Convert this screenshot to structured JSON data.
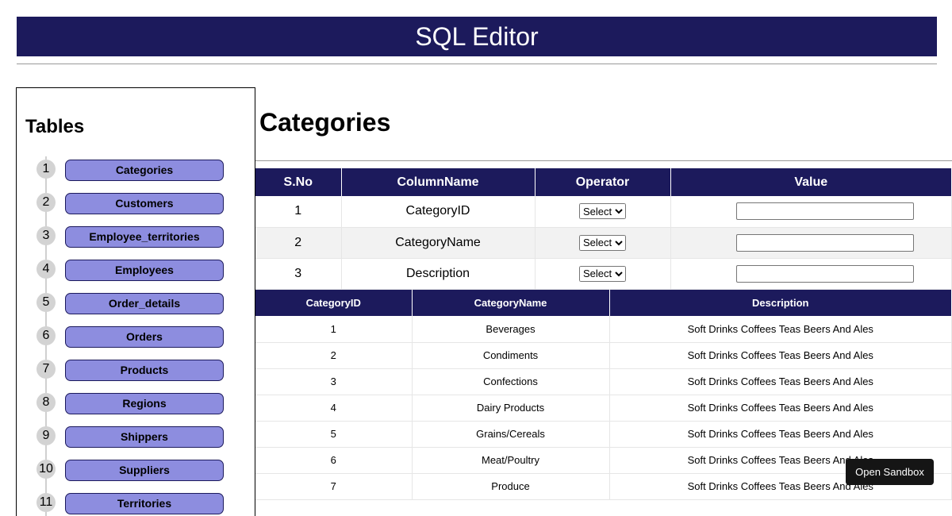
{
  "app": {
    "title": "SQL Editor"
  },
  "sidebar": {
    "title": "Tables",
    "items": [
      {
        "num": "1",
        "label": "Categories"
      },
      {
        "num": "2",
        "label": "Customers"
      },
      {
        "num": "3",
        "label": "Employee_territories"
      },
      {
        "num": "4",
        "label": "Employees"
      },
      {
        "num": "5",
        "label": "Order_details"
      },
      {
        "num": "6",
        "label": "Orders"
      },
      {
        "num": "7",
        "label": "Products"
      },
      {
        "num": "8",
        "label": "Regions"
      },
      {
        "num": "9",
        "label": "Shippers"
      },
      {
        "num": "10",
        "label": "Suppliers"
      },
      {
        "num": "11",
        "label": "Territories"
      }
    ]
  },
  "main": {
    "title": "Categories",
    "filter": {
      "headers": [
        "S.No",
        "ColumnName",
        "Operator",
        "Value"
      ],
      "rows": [
        {
          "sno": "1",
          "column": "CategoryID",
          "operator": "Select",
          "value": ""
        },
        {
          "sno": "2",
          "column": "CategoryName",
          "operator": "Select",
          "value": ""
        },
        {
          "sno": "3",
          "column": "Description",
          "operator": "Select",
          "value": ""
        }
      ]
    },
    "results": {
      "headers": [
        "CategoryID",
        "CategoryName",
        "Description"
      ],
      "rows": [
        [
          "1",
          "Beverages",
          "Soft Drinks Coffees Teas Beers And Ales"
        ],
        [
          "2",
          "Condiments",
          "Soft Drinks Coffees Teas Beers And Ales"
        ],
        [
          "3",
          "Confections",
          "Soft Drinks Coffees Teas Beers And Ales"
        ],
        [
          "4",
          "Dairy Products",
          "Soft Drinks Coffees Teas Beers And Ales"
        ],
        [
          "5",
          "Grains/Cereals",
          "Soft Drinks Coffees Teas Beers And Ales"
        ],
        [
          "6",
          "Meat/Poultry",
          "Soft Drinks Coffees Teas Beers And Ales"
        ],
        [
          "7",
          "Produce",
          "Soft Drinks Coffees Teas Beers And Ales"
        ]
      ]
    }
  },
  "sandbox": {
    "label": "Open Sandbox"
  },
  "colors": {
    "primary": "#1c1a5c",
    "button": "#8d8ddf",
    "badge": "#d3d3d3"
  }
}
